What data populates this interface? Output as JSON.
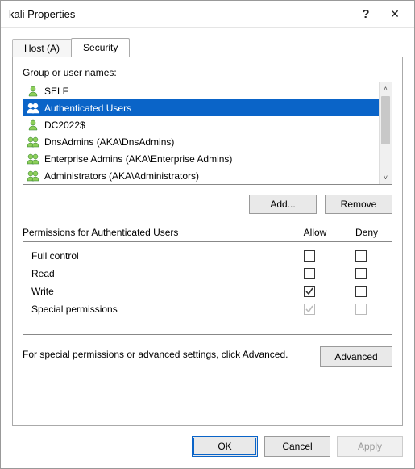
{
  "window": {
    "title": "kali Properties",
    "help_glyph": "?",
    "close_glyph": "✕"
  },
  "tabs": {
    "host": "Host (A)",
    "security": "Security"
  },
  "group_label": "Group or user names:",
  "principals": [
    {
      "name": "SELF",
      "type": "single",
      "selected": false
    },
    {
      "name": "Authenticated Users",
      "type": "group",
      "selected": true
    },
    {
      "name": "DC2022$",
      "type": "single",
      "selected": false
    },
    {
      "name": "DnsAdmins (AKA\\DnsAdmins)",
      "type": "group",
      "selected": false
    },
    {
      "name": "Enterprise Admins (AKA\\Enterprise Admins)",
      "type": "group",
      "selected": false
    },
    {
      "name": "Administrators (AKA\\Administrators)",
      "type": "group",
      "selected": false
    }
  ],
  "buttons": {
    "add": "Add...",
    "remove": "Remove",
    "advanced": "Advanced",
    "ok": "OK",
    "cancel": "Cancel",
    "apply": "Apply"
  },
  "perm_header": {
    "label": "Permissions for Authenticated Users",
    "allow": "Allow",
    "deny": "Deny"
  },
  "permissions": [
    {
      "name": "Full control",
      "allow": false,
      "deny": false,
      "disabled": false
    },
    {
      "name": "Read",
      "allow": false,
      "deny": false,
      "disabled": false
    },
    {
      "name": "Write",
      "allow": true,
      "deny": false,
      "disabled": false
    },
    {
      "name": "Special permissions",
      "allow": true,
      "deny": false,
      "disabled": true
    }
  ],
  "advanced_text": "For special permissions or advanced settings, click Advanced."
}
